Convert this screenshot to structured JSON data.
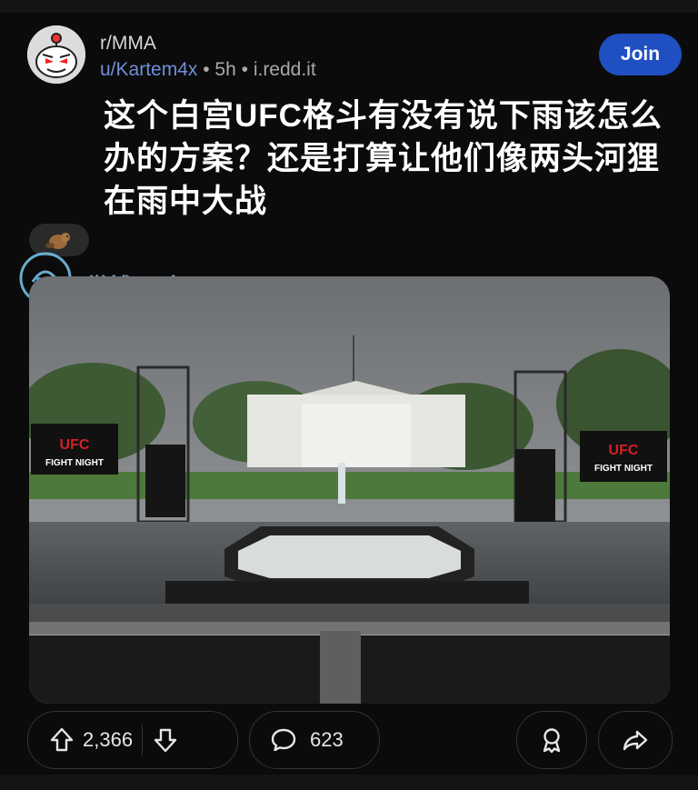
{
  "post": {
    "subreddit": "r/MMA",
    "username": "u/Kartem4x",
    "time": "5h",
    "domain": "i.redd.it",
    "join_label": "Join",
    "title": "这个白宫UFC格斗有没有说下雨该怎么办的方案？还是打算让他们像两头河狸在雨中大战"
  },
  "image": {
    "banner_text_1": "UFC",
    "banner_text_2": "FIGHT NIGHT"
  },
  "watermark": {
    "text": "微博:@今日memes"
  },
  "actions": {
    "upvotes": "2,366",
    "comments": "623"
  },
  "colors": {
    "accent": "#1f4fc0",
    "username": "#6f90d9",
    "background": "#0b0b0b"
  }
}
